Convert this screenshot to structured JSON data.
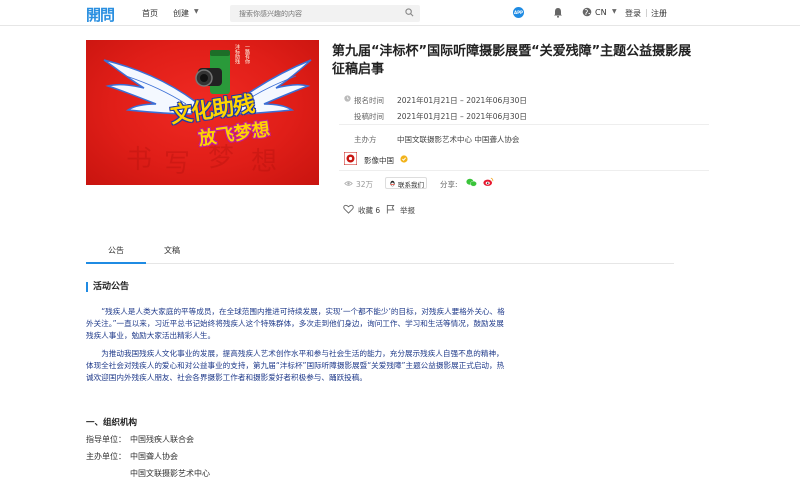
{
  "header": {
    "logo": "開問",
    "nav_home": "首页",
    "nav_create": "创建",
    "search_placeholder": "搜索你感兴趣的内容",
    "app_badge": "APP",
    "lang": "CN",
    "login": "登录",
    "separator": "|",
    "register": "注册"
  },
  "banner": {
    "vertical_text_1": "沣标助残",
    "vertical_text_2": "一路有你",
    "slogan_line1": "文化助残",
    "slogan_line2": "放飞梦想"
  },
  "event": {
    "title": "第九届“沣标杯”国际听障摄影展暨“关爱残障”主题公益摄影展征稿启事",
    "signup_label": "报名时间",
    "signup_value": "2021年01月21日 – 2021年06月30日",
    "submit_label": "投稿时间",
    "submit_value": "2021年01月21日 – 2021年06月30日",
    "organizer_label": "主办方",
    "organizer_value": "中国文联摄影艺术中心 中国聋人协会",
    "publisher": "影像中国",
    "views": "32万",
    "contact": "联系我们",
    "share_label": "分享:",
    "favorite": "收藏 6",
    "report": "举报"
  },
  "tabs": [
    {
      "label": "公告"
    },
    {
      "label": "文稿"
    }
  ],
  "content": {
    "section_title": "活动公告",
    "para1": "“残疾人是人类大家庭的平等成员，在全球范围内推进可持续发展，实现‘一个都不能少’的目标，对残疾人要格外关心、格外关注。”一直以来，习近平总书记始终将残疾人这个特殊群体，多次走到他们身边，询问工作、学习和生活等情况，鼓励发展残疾人事业，勉励大家活出精彩人生。",
    "para2": "为推动我国残疾人文化事业的发展，提高残疾人艺术创作水平和参与社会生活的能力，充分展示残疾人自强不息的精神，体现全社会对残疾人的爱心和对公益事业的支持，第九届“沣标杯”国际听障摄影展暨“关爱残障”主题公益摄影展正式启动，热诚欢迎国内外残疾人朋友、社会各界摄影工作者和摄影爱好者积极参与、踊跃投稿。",
    "h2": "一、组织机构",
    "guide_label": "指导单位：",
    "guide_value": "中国残疾人联合会",
    "host_label": "主办单位：",
    "host_value1": "中国聋人协会",
    "host_value2": "中国文联摄影艺术中心"
  },
  "colors": {
    "accent": "#1f8be3",
    "banner_red": "#e01e18",
    "text_blue": "#1f3a8a"
  }
}
